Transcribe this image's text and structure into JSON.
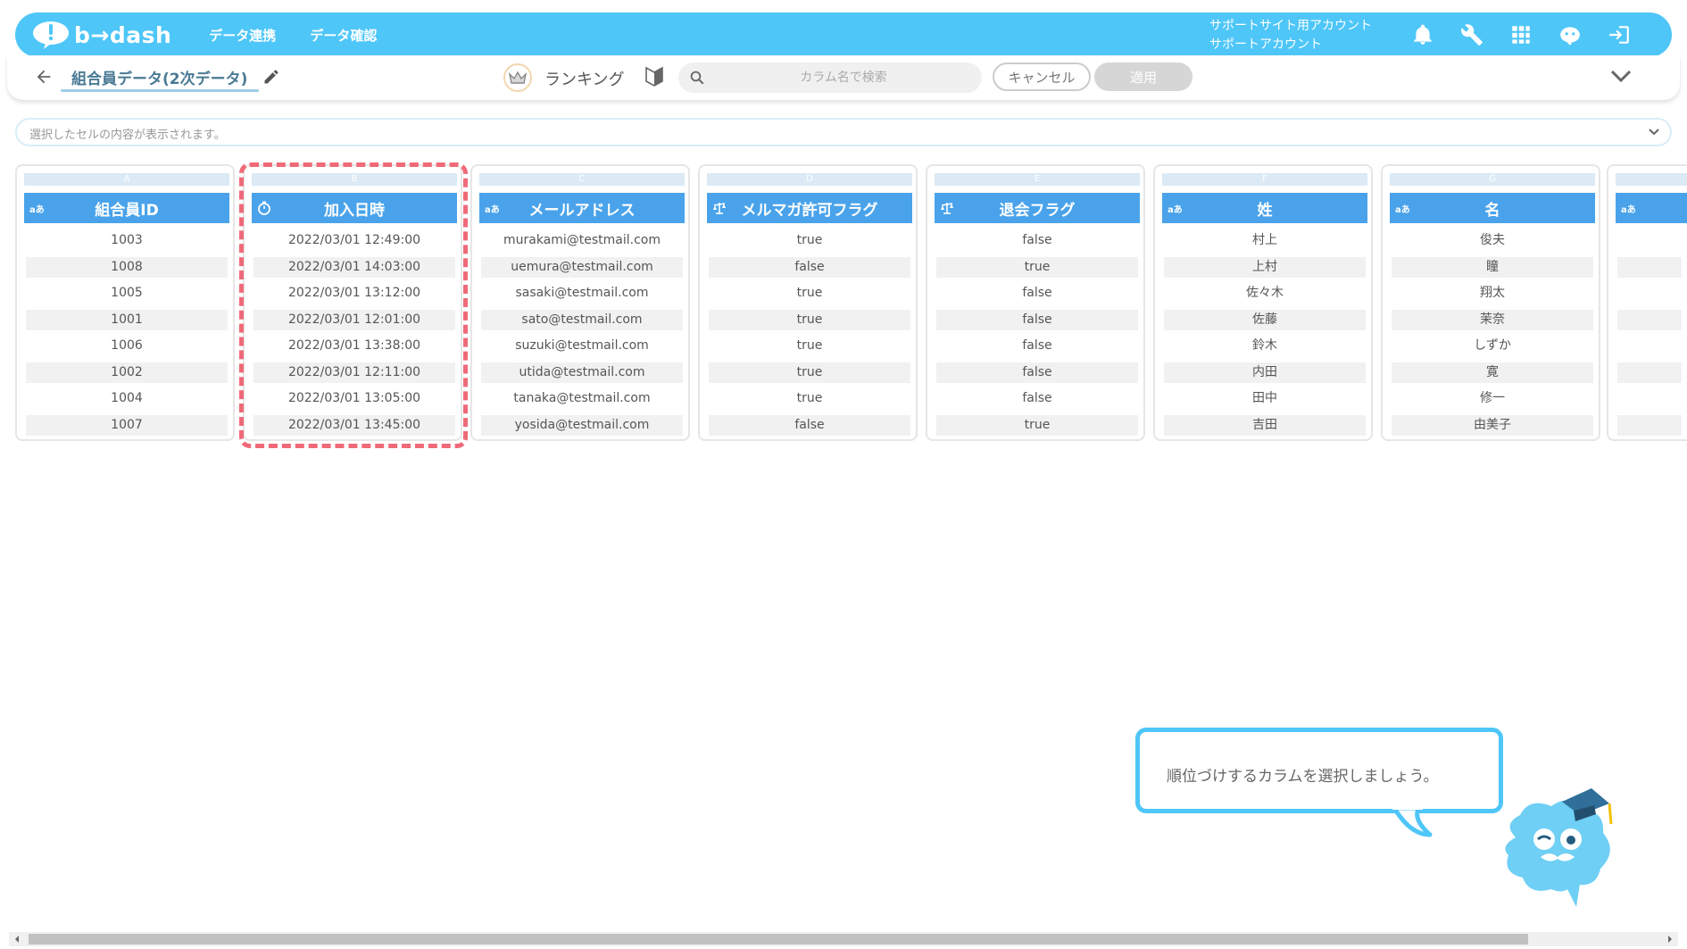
{
  "brand": {
    "name": "b→dash"
  },
  "nav": [
    "データ連携",
    "データ確認"
  ],
  "account": {
    "line1": "サポートサイト用アカウント",
    "line2": "サポートアカウント"
  },
  "top_icons": [
    "bell-icon",
    "wrench-icon",
    "apps-grid-icon",
    "mascot-icon",
    "logout-icon"
  ],
  "subbar": {
    "dataset_name": "組合員データ(2次データ)",
    "mode_label": "ランキング",
    "search_placeholder": "カラム名で検索",
    "cancel_label": "キャンセル",
    "apply_label": "適用"
  },
  "cell_content": {
    "placeholder": "選択したセルの内容が表示されます。"
  },
  "columns": [
    {
      "letter": "A",
      "header": "組合員ID",
      "type": "text",
      "type_label": "aあ",
      "values": [
        "1003",
        "1008",
        "1005",
        "1001",
        "1006",
        "1002",
        "1004",
        "1007"
      ]
    },
    {
      "letter": "B",
      "header": "加入日時",
      "type": "datetime",
      "type_label": "",
      "values": [
        "2022/03/01 12:49:00",
        "2022/03/01 14:03:00",
        "2022/03/01 13:12:00",
        "2022/03/01 12:01:00",
        "2022/03/01 13:38:00",
        "2022/03/01 12:11:00",
        "2022/03/01 13:05:00",
        "2022/03/01 13:45:00"
      ]
    },
    {
      "letter": "C",
      "header": "メールアドレス",
      "type": "text",
      "type_label": "aあ",
      "values": [
        "murakami@testmail.com",
        "uemura@testmail.com",
        "sasaki@testmail.com",
        "sato@testmail.com",
        "suzuki@testmail.com",
        "utida@testmail.com",
        "tanaka@testmail.com",
        "yosida@testmail.com"
      ]
    },
    {
      "letter": "D",
      "header": "メルマガ許可フラグ",
      "type": "boolean",
      "type_label": "",
      "values": [
        "true",
        "false",
        "true",
        "true",
        "true",
        "true",
        "true",
        "false"
      ]
    },
    {
      "letter": "E",
      "header": "退会フラグ",
      "type": "boolean",
      "type_label": "",
      "values": [
        "false",
        "true",
        "false",
        "false",
        "false",
        "false",
        "false",
        "true"
      ]
    },
    {
      "letter": "F",
      "header": "姓",
      "type": "text",
      "type_label": "aあ",
      "values": [
        "村上",
        "上村",
        "佐々木",
        "佐藤",
        "鈴木",
        "内田",
        "田中",
        "吉田"
      ]
    },
    {
      "letter": "G",
      "header": "名",
      "type": "text",
      "type_label": "aあ",
      "values": [
        "俊夫",
        "瞳",
        "翔太",
        "茉奈",
        "しずか",
        "寛",
        "修一",
        "由美子"
      ]
    }
  ],
  "partial_column": {
    "type_label": "aあ"
  },
  "tutorial": {
    "message": "順位づけするカラムを選択しましょう。"
  },
  "colors": {
    "brand": "#4ec6f8",
    "header": "#4aa3ea",
    "highlight": "#ef6a78"
  }
}
